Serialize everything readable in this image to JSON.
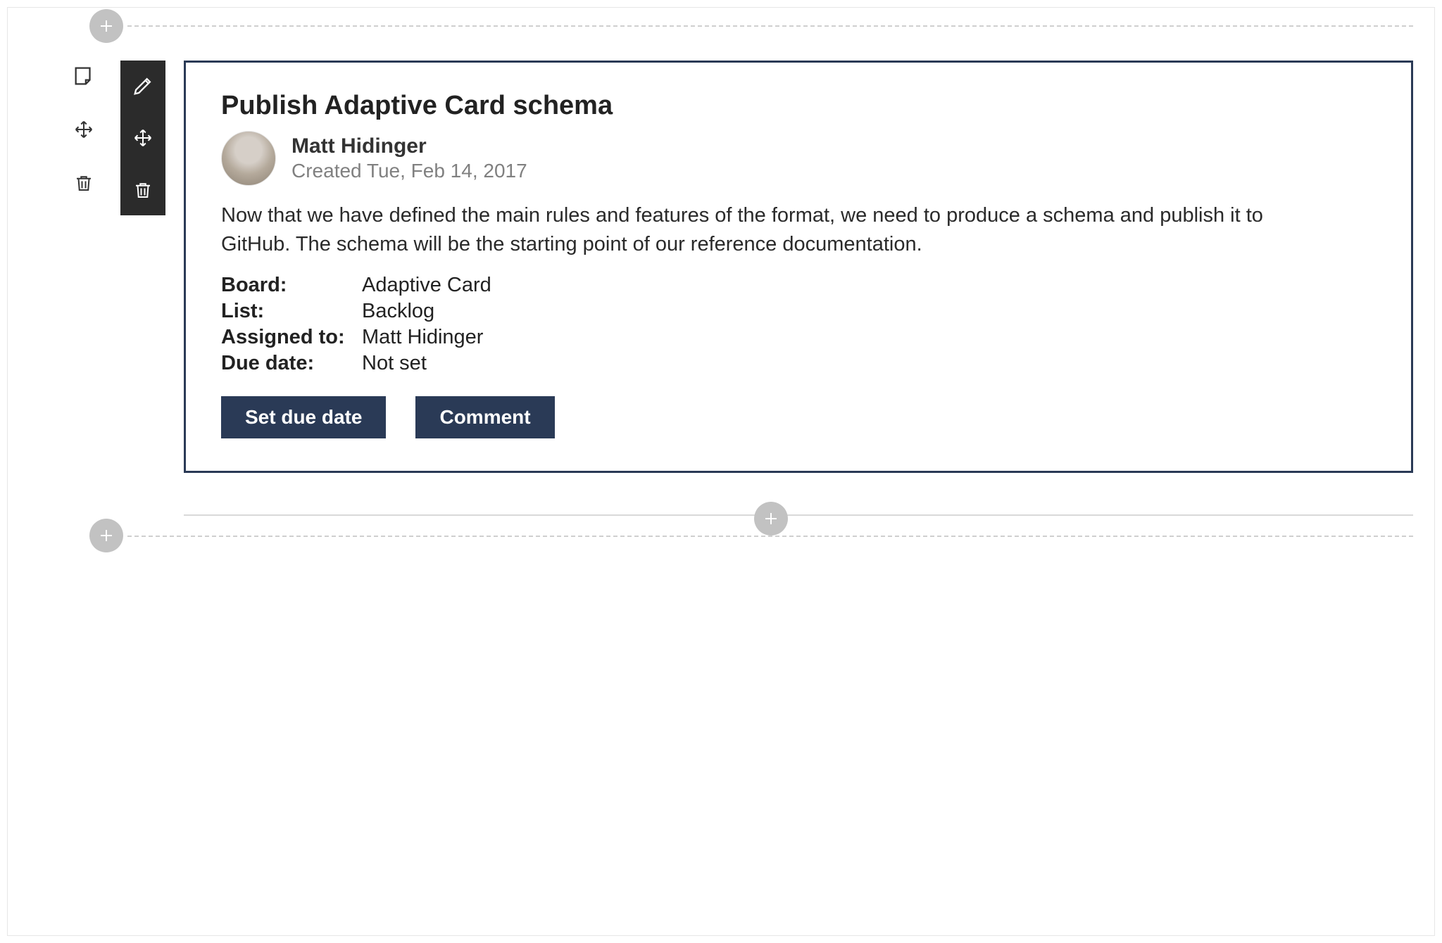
{
  "card": {
    "title": "Publish Adaptive Card schema",
    "author": {
      "name": "Matt Hidinger",
      "created": "Created Tue, Feb 14, 2017"
    },
    "description": "Now that we have defined the main rules and features of the format, we need to produce a schema and publish it to GitHub. The schema will be the starting point of our reference documentation.",
    "facts": [
      {
        "label": "Board:",
        "value": "Adaptive Card"
      },
      {
        "label": "List:",
        "value": "Backlog"
      },
      {
        "label": "Assigned to:",
        "value": "Matt Hidinger"
      },
      {
        "label": "Due date:",
        "value": "Not set"
      }
    ],
    "actions": {
      "set_due_date": "Set due date",
      "comment": "Comment"
    }
  },
  "toolbar_light": {
    "note": "note-icon",
    "move": "move-icon",
    "trash": "trash-icon"
  },
  "toolbar_dark": {
    "edit": "pencil-icon",
    "move": "move-icon",
    "trash": "trash-icon"
  },
  "colors": {
    "primary": "#2a3a56",
    "toolbar_dark_bg": "#2b2b2b",
    "muted": "#808080"
  }
}
